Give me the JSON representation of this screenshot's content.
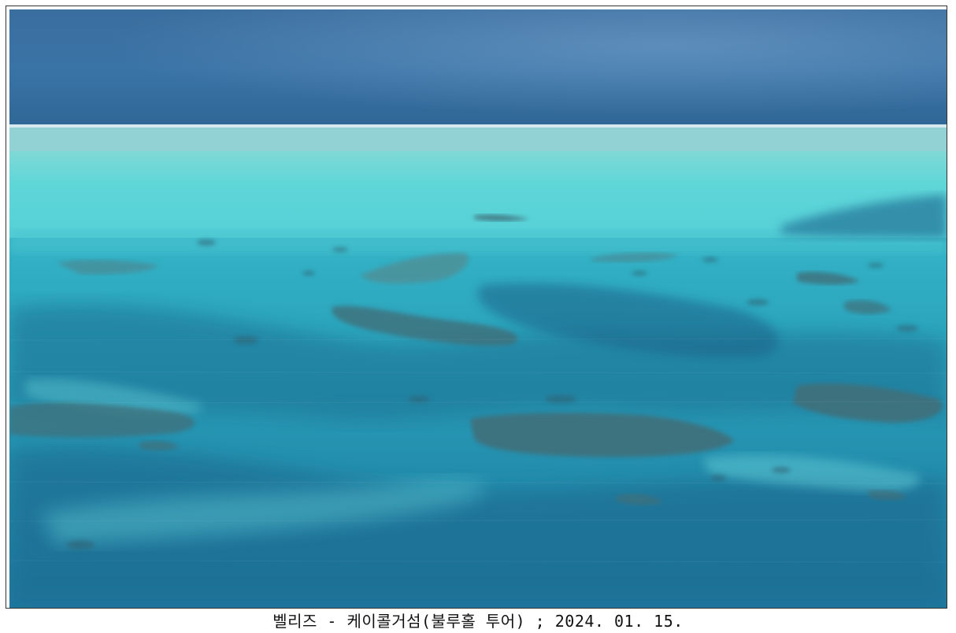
{
  "photo": {
    "subject": "aerial-reef-seascape",
    "colors": {
      "deep_ocean": "#2f5f8f",
      "horizon_band": "#3a73a6",
      "surf_line": "#eaf6f8",
      "shallow_lagoon": "#5fd6d8",
      "mid_water": "#2aa2bb",
      "deep_channel": "#1f6f92",
      "reef_patch": "#3f6f7a"
    }
  },
  "caption": {
    "text": "벨리즈 - 케이콜거섬(불루홀 투어) ; 2024. 01. 15."
  }
}
